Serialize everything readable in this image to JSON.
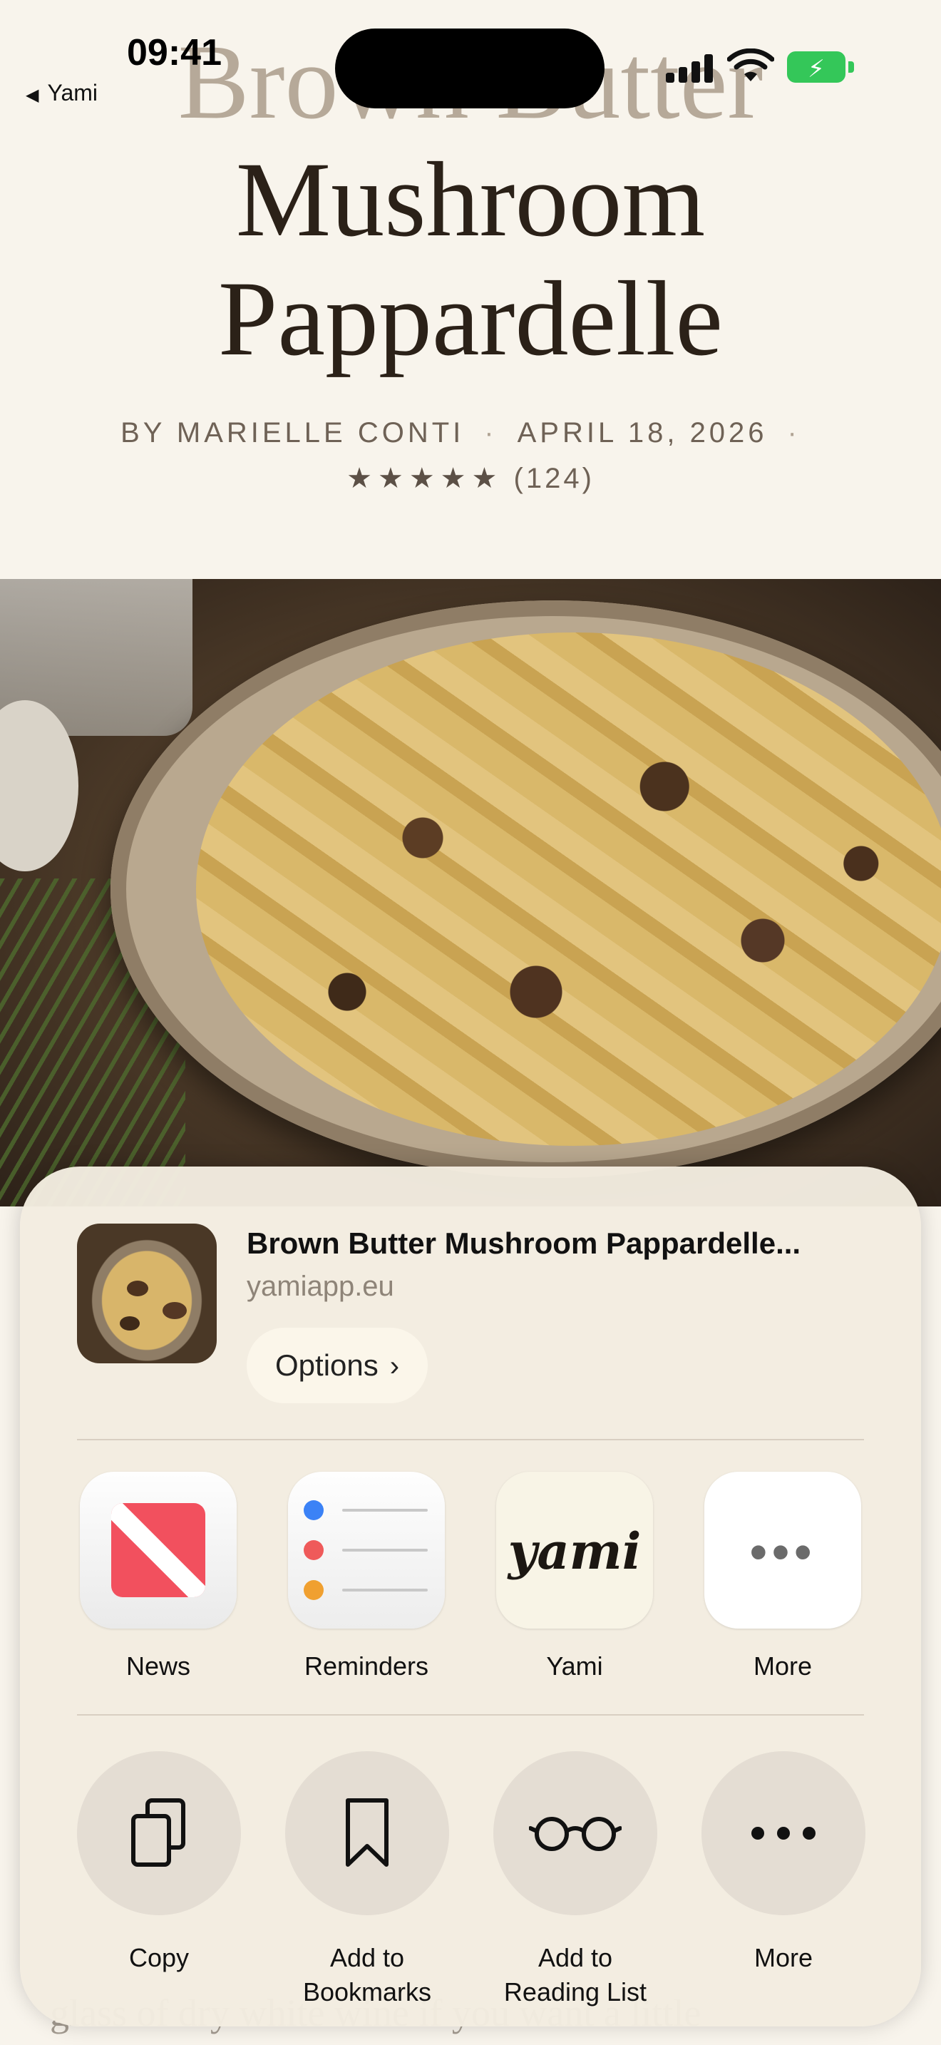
{
  "statusbar": {
    "time": "09:41",
    "back_label": "Yami"
  },
  "article": {
    "title_lines": [
      "Brown Butter",
      "Mushroom",
      "Pappardelle"
    ],
    "author": "BY MARIELLE CONTI",
    "date": "APRIL 18, 2026",
    "stars": "★★★★★",
    "rating_count": "(124)",
    "body_fragment": "glass of dry white wine if you want a little"
  },
  "share_sheet": {
    "title": "Brown Butter Mushroom Pappardelle...",
    "url": "yamiapp.eu",
    "options_label": "Options",
    "apps": [
      {
        "label": "News",
        "icon": "news-icon"
      },
      {
        "label": "Reminders",
        "icon": "reminders-icon"
      },
      {
        "label": "Yami",
        "icon": "yami-icon",
        "wordmark": "yami"
      },
      {
        "label": "More",
        "icon": "more-icon"
      }
    ],
    "actions": [
      {
        "label_lines": [
          "Copy"
        ],
        "icon": "copy-icon"
      },
      {
        "label_lines": [
          "Add to",
          "Bookmarks"
        ],
        "icon": "bookmark-icon"
      },
      {
        "label_lines": [
          "Add to",
          "Reading List"
        ],
        "icon": "glasses-icon"
      },
      {
        "label_lines": [
          "More"
        ],
        "icon": "more-icon"
      }
    ]
  },
  "colors": {
    "page_bg": "#f8f4ec",
    "battery": "#34c759",
    "news_red": "#f2505e",
    "reminder_dots": [
      "#3b82f6",
      "#ef5a5a",
      "#f0a030"
    ]
  }
}
